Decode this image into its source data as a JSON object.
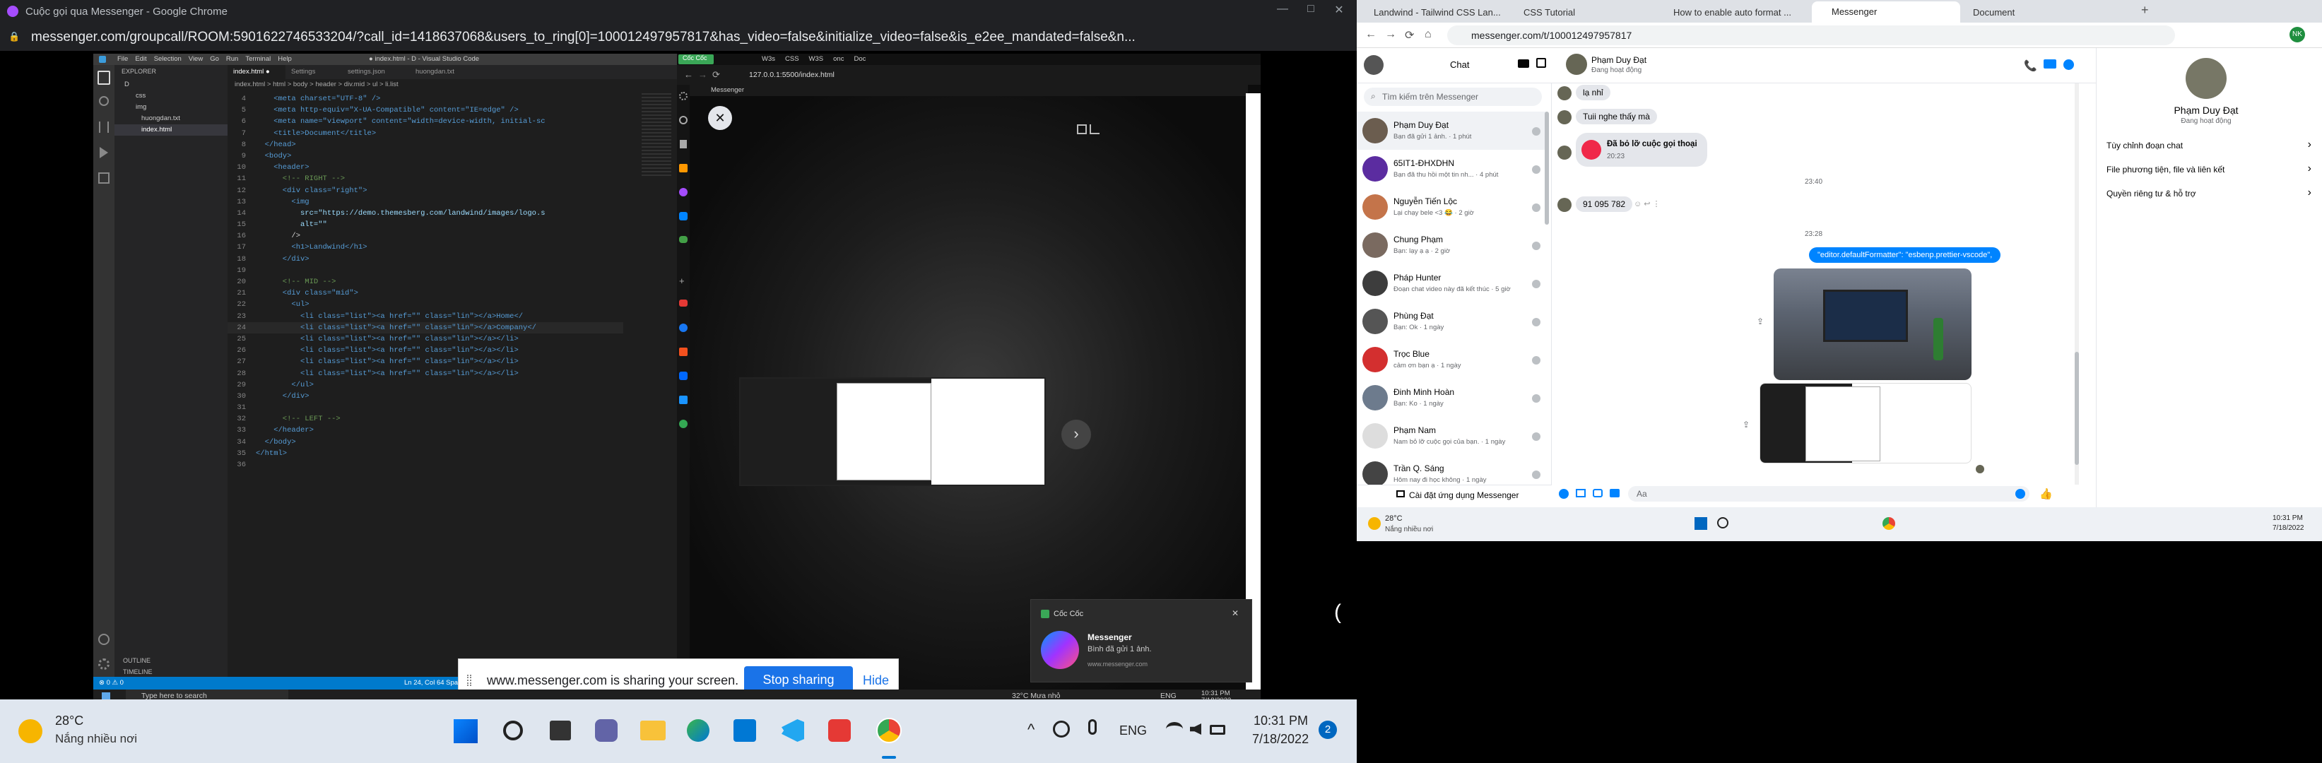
{
  "left_window": {
    "title": "Cuộc gọi qua Messenger - Google Chrome",
    "url": "messenger.com/groupcall/ROOM:5901622746533204/?call_id=1418637068&users_to_ring[0]=100012497957817&has_video=false&initialize_video=false&is_e2ee_mandated=false&n..."
  },
  "vscode": {
    "menu": [
      "File",
      "Edit",
      "Selection",
      "View",
      "Go",
      "Run",
      "Terminal",
      "Help"
    ],
    "title": "● index.html - D - Visual Studio Code",
    "explorer_label": "EXPLORER",
    "tabs": [
      "index.html",
      "Settings",
      "settings.json",
      "huongdan.txt"
    ],
    "breadcrumb": "index.html > html > body > header > div.mid > ul > li.list",
    "tree": [
      "D",
      "css",
      "img",
      "huongdan.txt",
      "index.html"
    ],
    "outline": "OUTLINE",
    "timeline": "TIMELINE",
    "status_left": "⊗ 0 ⚠ 0",
    "status_right": "Ln 24, Col 64   Spaces: 4",
    "code": [
      {
        "n": "4",
        "t": "    <meta charset=\"UTF-8\" />"
      },
      {
        "n": "5",
        "t": "    <meta http-equiv=\"X-UA-Compatible\" content=\"IE=edge\" />"
      },
      {
        "n": "6",
        "t": "    <meta name=\"viewport\" content=\"width=device-width, initial-sc"
      },
      {
        "n": "7",
        "t": "    <title>Document</title>"
      },
      {
        "n": "8",
        "t": "  </head>"
      },
      {
        "n": "9",
        "t": "  <body>"
      },
      {
        "n": "10",
        "t": "    <header>"
      },
      {
        "n": "11",
        "t": "      <!-- RIGHT -->"
      },
      {
        "n": "12",
        "t": "      <div class=\"right\">"
      },
      {
        "n": "13",
        "t": "        <img"
      },
      {
        "n": "14",
        "t": "          src=\"https://demo.themesberg.com/landwind/images/logo.s"
      },
      {
        "n": "15",
        "t": "          alt=\"\""
      },
      {
        "n": "16",
        "t": "        />"
      },
      {
        "n": "17",
        "t": "        <h1>Landwind</h1>"
      },
      {
        "n": "18",
        "t": "      </div>"
      },
      {
        "n": "19",
        "t": ""
      },
      {
        "n": "20",
        "t": "      <!-- MID -->"
      },
      {
        "n": "21",
        "t": "      <div class=\"mid\">"
      },
      {
        "n": "22",
        "t": "        <ul>"
      },
      {
        "n": "23",
        "t": "          <li class=\"list\"><a href=\"\" class=\"lin\"></a>Home</"
      },
      {
        "n": "24",
        "t": "          <li class=\"list\"><a href=\"\" class=\"lin\"></a>Company</"
      },
      {
        "n": "25",
        "t": "          <li class=\"list\"><a href=\"\" class=\"lin\"></a></li>"
      },
      {
        "n": "26",
        "t": "          <li class=\"list\"><a href=\"\" class=\"lin\"></a></li>"
      },
      {
        "n": "27",
        "t": "          <li class=\"list\"><a href=\"\" class=\"lin\"></a></li>"
      },
      {
        "n": "28",
        "t": "          <li class=\"list\"><a href=\"\" class=\"lin\"></a></li>"
      },
      {
        "n": "29",
        "t": "        </ul>"
      },
      {
        "n": "30",
        "t": "      </div>"
      },
      {
        "n": "31",
        "t": ""
      },
      {
        "n": "32",
        "t": "      <!-- LEFT -->"
      },
      {
        "n": "33",
        "t": "    </header>"
      },
      {
        "n": "34",
        "t": "  </body>"
      },
      {
        "n": "35",
        "t": "</html>"
      },
      {
        "n": "36",
        "t": ""
      }
    ]
  },
  "coccoc": {
    "logo": "Cốc Cốc",
    "tabs": [
      "W3s",
      "CSS",
      "W3S",
      "onc",
      "Doc"
    ],
    "url": "127.0.0.1:5500/index.html",
    "viewer_title": "Messenger"
  },
  "share_bar": {
    "text": "www.messenger.com is sharing your screen.",
    "stop": "Stop sharing",
    "hide": "Hide"
  },
  "notification": {
    "app": "Cốc Cốc",
    "title": "Messenger",
    "body": "Bình đã gửi 1 ảnh.",
    "site": "www.messenger.com"
  },
  "inner_taskbar": {
    "search": "Type here to search",
    "weather": "32°C  Mưa nhỏ",
    "lang": "ENG",
    "time": "10:31 PM",
    "date": "7/18/2022"
  },
  "bottom_taskbar": {
    "temp": "28°C",
    "weather": "Nắng nhiều nơi",
    "lang": "ENG",
    "time": "10:31 PM",
    "date": "7/18/2022",
    "badge": "2"
  },
  "right_window": {
    "tabs": [
      "Landwind - Tailwind CSS Lan...",
      "CSS Tutorial",
      "How to enable auto format ...",
      "Messenger",
      "Document"
    ],
    "url": "messenger.com/t/100012497957817",
    "chat_header": "Chat",
    "search_placeholder": "Tìm kiếm trên Messenger",
    "conversations": [
      {
        "name": "Phạm Duy Đạt",
        "preview": "Bạn đã gửi 1 ảnh. · 1 phút"
      },
      {
        "name": "65IT1-ĐHXDHN",
        "preview": "Bạn đã thu hồi một tin nh... · 4 phút"
      },
      {
        "name": "Nguyễn Tiến Lộc",
        "preview": "Lại chạy bele <3 😂 · 2 giờ"
      },
      {
        "name": "Chung Phạm",
        "preview": "Bạn: lạy ạ ạ · 2 giờ"
      },
      {
        "name": "Pháp Hunter",
        "preview": "Đoạn chat video này đã kết thúc · 5 giờ"
      },
      {
        "name": "Phùng Đạt",
        "preview": "Bạn: Ok · 1 ngày"
      },
      {
        "name": "Trọc Blue",
        "preview": "cảm ơn bạn ạ · 1 ngày"
      },
      {
        "name": "Đinh Minh Hoàn",
        "preview": "Bạn: Ko · 1 ngày"
      },
      {
        "name": "Phạm Nam",
        "preview": "Nam bỏ lỡ cuộc gọi của bạn. · 1 ngày"
      },
      {
        "name": "Trần Q. Sáng",
        "preview": "Hôm nay đi học không · 1 ngày"
      }
    ],
    "install_label": "Cài đặt ứng dụng Messenger",
    "contact_name": "Phạm Duy Đạt",
    "contact_status": "Đang hoạt động",
    "messages": {
      "m1": "lạ nhỉ",
      "m2": "Tuii nghe thấy mà",
      "missed_call": "Đã bỏ lỡ cuộc gọi thoại",
      "missed_time": "20:23",
      "time1": "23:40",
      "m3": "91 095 782",
      "time2": "23:28",
      "sent": "\"editor.defaultFormatter\": \"esbenp.prettier-vscode\","
    },
    "composer_placeholder": "Aa",
    "profile": {
      "name": "Phạm Duy Đạt",
      "status": "Đang hoạt động",
      "options": [
        "Tùy chỉnh đoạn chat",
        "File phương tiện, file và liên kết",
        "Quyền riêng tư & hỗ trợ"
      ]
    },
    "taskbar": {
      "temp": "28°C",
      "weather": "Nắng nhiều nơi",
      "time": "10:31 PM",
      "date": "7/18/2022"
    }
  }
}
